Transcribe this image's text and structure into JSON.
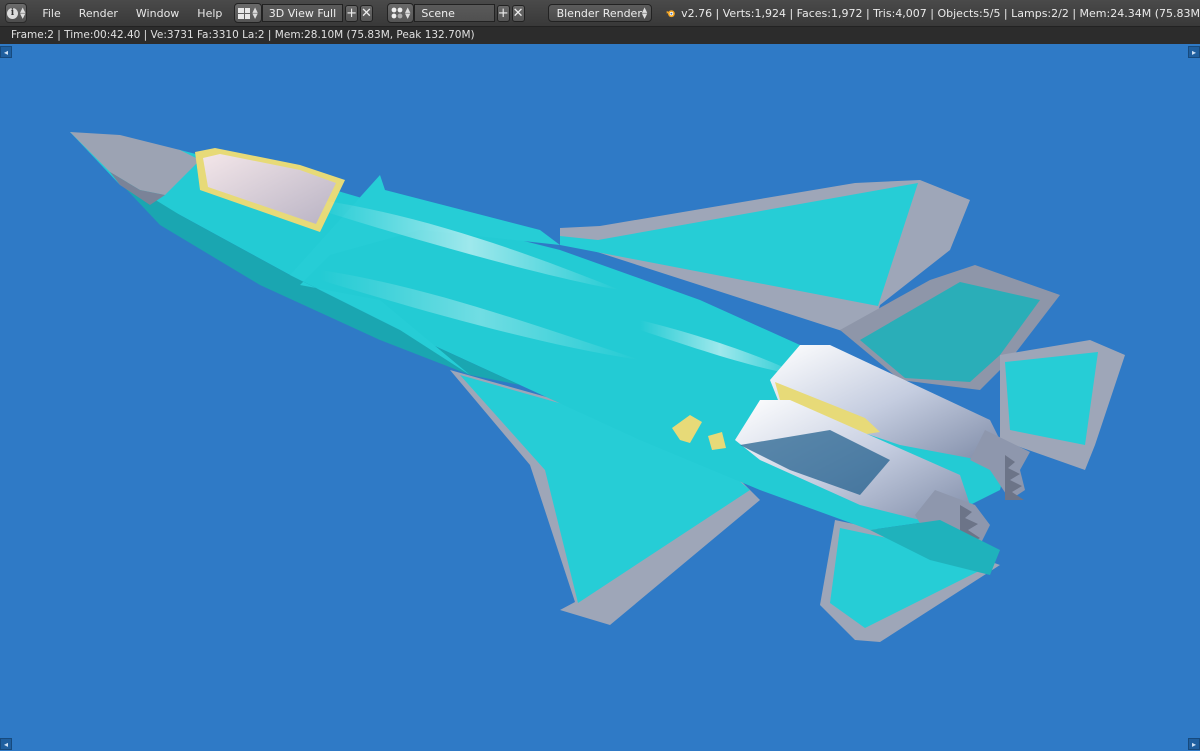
{
  "header": {
    "menu": [
      "File",
      "Render",
      "Window",
      "Help"
    ],
    "screen_layout": "3D View Full",
    "scene": "Scene",
    "render_engine": "Blender Render",
    "stats": "v2.76 | Verts:1,924 | Faces:1,972 | Tris:4,007 | Objects:5/5 | Lamps:2/2 | Mem:24.34M (75.83M"
  },
  "render_info": "Frame:2 | Time:00:42.40 | Ve:3731 Fa:3310 La:2 | Mem:28.10M (75.83M, Peak 132.70M)",
  "icons": {
    "info": "info-icon",
    "layout": "screen-layout-icon",
    "scene": "scene-icon",
    "add": "plus-icon",
    "close": "x-icon",
    "dropdown": "updown-arrow-icon",
    "logo": "blender-logo-icon"
  },
  "colors": {
    "background": "#2f7ac6",
    "header": "#414141",
    "jet_body": "#23cbd4",
    "jet_edges": "#9aa3b4"
  }
}
